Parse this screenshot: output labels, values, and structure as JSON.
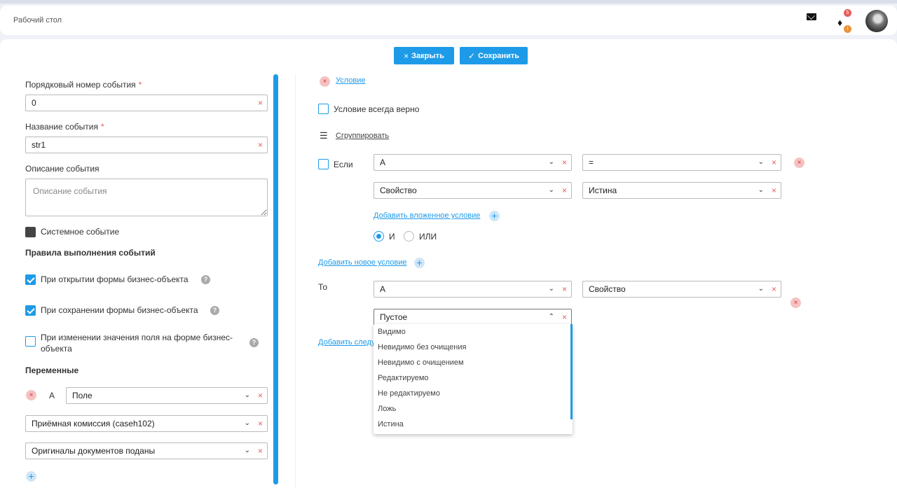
{
  "header": {
    "title": "Рабочий стол",
    "badge_red": "5",
    "badge_orange": "!"
  },
  "toolbar": {
    "close_label": "Закрыть",
    "save_label": "Сохранить"
  },
  "form": {
    "order_label": "Порядковый номер события",
    "order_value": "0",
    "name_label": "Название события",
    "name_value": "str1",
    "desc_label": "Описание события",
    "desc_placeholder": "Описание события",
    "system_event_label": "Системное событие",
    "rules_heading": "Правила выполнения событий",
    "rule_open": "При открытии формы бизнес-объекта",
    "rule_save": "При сохранении формы бизнес-объекта",
    "rule_change_l1": "При изменении значения поля на форме бизнес-",
    "rule_change_l2": "объекта",
    "variables_heading": "Переменные",
    "var_name": "А",
    "var_field": "Поле",
    "var_entity": "Приёмная комиссия (caseh102)",
    "var_attr": "Оригиналы документов поданы",
    "required_mark": "*",
    "help_mark": "?"
  },
  "condition": {
    "condition_link": "Условие",
    "always_true": "Условие всегда верно",
    "group_link": "Сгруппировать",
    "if_label": "Если",
    "if_left": "А",
    "if_op": "=",
    "if_prop": "Свойство",
    "if_value": "Истина",
    "add_nested": "Добавить вложенное условие",
    "and_label": "И",
    "or_label": "ИЛИ",
    "add_new": "Добавить новое условие",
    "then_label": "То",
    "then_left": "А",
    "then_prop": "Свойство",
    "then_value": "Пустое",
    "add_next": "Добавить следующее"
  },
  "dropdown": {
    "options": [
      "Видимо",
      "Невидимо без очищения",
      "Невидимо с очищением",
      "Редактируемо",
      "Не редактируемо",
      "Ложь",
      "Истина"
    ]
  },
  "icons": {
    "close": "×",
    "check": "✓",
    "chevron_down": "⌄",
    "chevron_up": "⌃",
    "plus": "+",
    "bell": "🔔",
    "group": "☰"
  },
  "colors": {
    "accent": "#1e9be8",
    "danger": "#e85a5a"
  }
}
